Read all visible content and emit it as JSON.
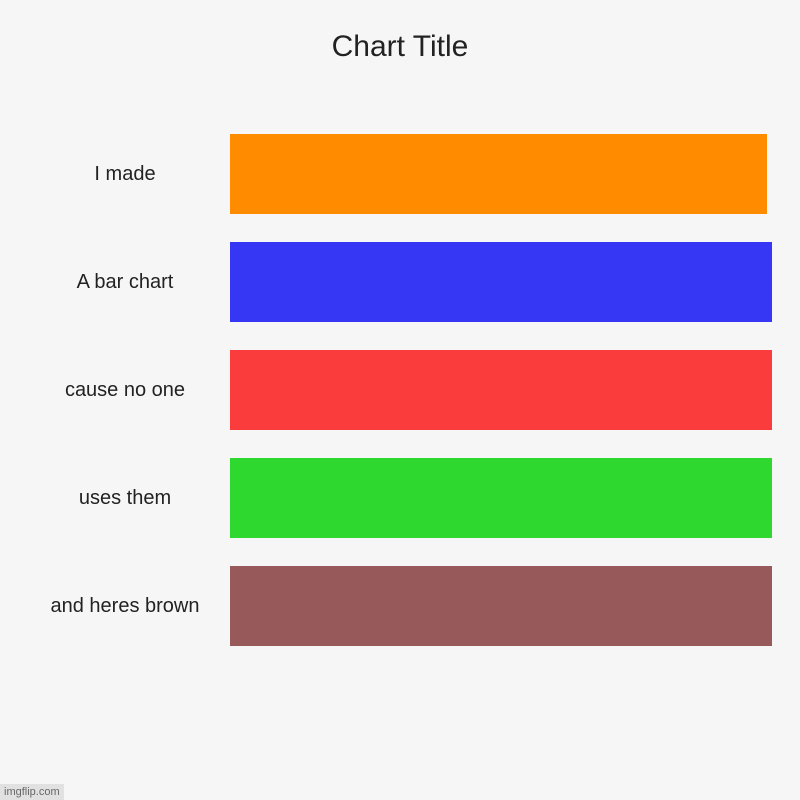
{
  "chart_data": {
    "type": "bar",
    "orientation": "horizontal",
    "title": "Chart Title",
    "categories": [
      "I made",
      "A bar chart",
      "cause no one",
      "uses them",
      "and heres brown"
    ],
    "values": [
      99,
      100,
      100,
      100,
      100
    ],
    "xlim": [
      0,
      100
    ],
    "series": [
      {
        "label": "I made",
        "value": 99,
        "color": "#ff8c00"
      },
      {
        "label": "A bar chart",
        "value": 100,
        "color": "#3636f5"
      },
      {
        "label": "cause no one",
        "value": 100,
        "color": "#fb3c3c"
      },
      {
        "label": "uses them",
        "value": 100,
        "color": "#2fd82f"
      },
      {
        "label": "and heres brown",
        "value": 100,
        "color": "#975959"
      }
    ]
  },
  "watermark": "imgflip.com"
}
